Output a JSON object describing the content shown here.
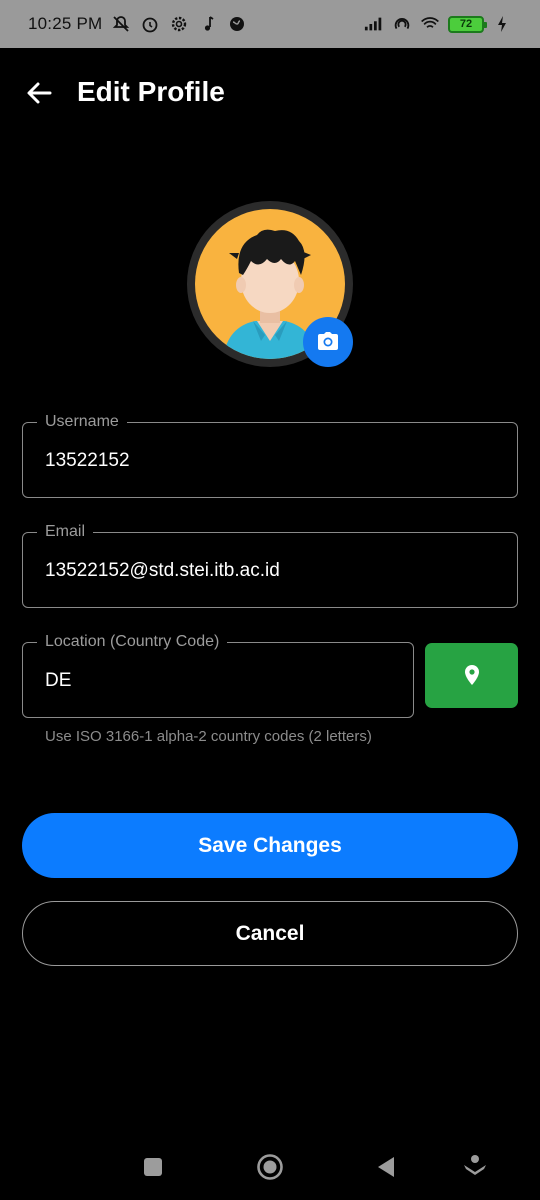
{
  "status_bar": {
    "time": "10:25 PM",
    "battery_level": "72",
    "icons_left": [
      "mute-icon",
      "alarm-icon",
      "settings-icon",
      "music-icon",
      "globe-icon"
    ],
    "icons_right": [
      "signal-icon",
      "hotspot-icon",
      "wifi-icon",
      "battery-icon",
      "charging-icon"
    ]
  },
  "header": {
    "title": "Edit Profile",
    "back_icon": "arrow-left-icon"
  },
  "profile": {
    "avatar_icon": "user-avatar",
    "camera_icon": "camera-icon"
  },
  "form": {
    "username": {
      "label": "Username",
      "value": "13522152"
    },
    "email": {
      "label": "Email",
      "value": "13522152@std.stei.itb.ac.id"
    },
    "location": {
      "label": "Location (Country Code)",
      "value": "DE",
      "helper": "Use ISO 3166-1 alpha-2 country codes (2 letters)",
      "button_icon": "location-pin-icon"
    }
  },
  "actions": {
    "save_label": "Save Changes",
    "cancel_label": "Cancel"
  },
  "nav_bar": {
    "buttons": [
      "recents-icon",
      "home-icon",
      "back-icon",
      "assistant-icon"
    ]
  },
  "colors": {
    "background": "#000000",
    "primary": "#0C7CFF",
    "location_button": "#27A343",
    "avatar_bg": "#F9B33F",
    "field_border": "#8A8A8A"
  }
}
